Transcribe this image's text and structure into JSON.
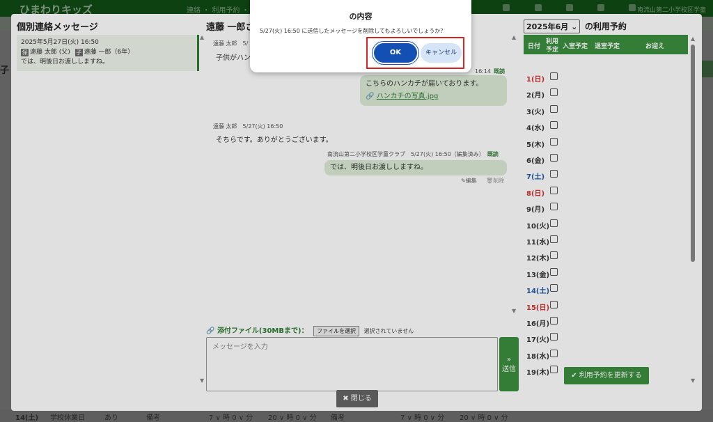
{
  "bg": {
    "app_name": "ひまわりキッズ",
    "menu": "連絡 ・ 利用予約 ・ 登降所",
    "user": "南流山第二小学校区学童",
    "side_label": "子",
    "footer": {
      "day": "14(土)",
      "c1": "学校休業日",
      "c2": "あり",
      "c3": "備考",
      "c4": "7 ∨ 時 0 ∨ 分",
      "c5": "20 ∨ 時 0 ∨ 分",
      "c6": "備考",
      "c7": "7 ∨ 時 0 ∨ 分",
      "c8": "20 ∨ 時 0 ∨ 分"
    }
  },
  "left": {
    "title": "個別連絡メッセージ",
    "conv": {
      "date": "2025年5月27日(火) 16:50",
      "parent_tag": "保",
      "parent": "遠藤 太郎 (父)",
      "child_tag": "子",
      "child": "遠藤 一郎（6年）",
      "preview": "では、明後日お渡ししますね。"
    }
  },
  "mid": {
    "title": "遠藤 一郎さ",
    "msg1": {
      "meta": "遠藤 太郎　5/",
      "text": "子供がハン"
    },
    "msg2": {
      "meta_tail": "16:14",
      "read": "既読",
      "text": "こちらのハンカチが届いております。",
      "attachment": "ハンカチの写真.jpg"
    },
    "msg3": {
      "meta": "遠藤 太郎　5/27(火) 16:50",
      "text": "そちらです。ありがとうございます。"
    },
    "msg4": {
      "meta": "南流山第二小学校区学童クラブ　5/27(火) 16:50（編集済み）",
      "read": "既読",
      "text": "では、明後日お渡ししますね。",
      "edit": "編集",
      "delete": "削除"
    },
    "attach_label": "添付ファイル(30MBまで)：",
    "file_button": "ファイルを選択",
    "no_file": "選択されていません",
    "input_placeholder": "メッセージを入力",
    "send": "送信"
  },
  "right": {
    "month": "2025年6月",
    "title": "の利用予約",
    "headers": {
      "date": "日付",
      "use1": "利用",
      "use2": "予定",
      "enter": "入室予定",
      "leave": "退室予定",
      "pickup": "お迎え"
    },
    "rows": [
      {
        "d": "1(日)",
        "c": "#d32f2f"
      },
      {
        "d": "2(月)",
        "c": "#333333"
      },
      {
        "d": "3(火)",
        "c": "#333333"
      },
      {
        "d": "4(水)",
        "c": "#333333"
      },
      {
        "d": "5(木)",
        "c": "#333333"
      },
      {
        "d": "6(金)",
        "c": "#333333"
      },
      {
        "d": "7(土)",
        "c": "#1e5aa8"
      },
      {
        "d": "8(日)",
        "c": "#d32f2f"
      },
      {
        "d": "9(月)",
        "c": "#333333"
      },
      {
        "d": "10(火)",
        "c": "#333333"
      },
      {
        "d": "11(水)",
        "c": "#333333"
      },
      {
        "d": "12(木)",
        "c": "#333333"
      },
      {
        "d": "13(金)",
        "c": "#333333"
      },
      {
        "d": "14(土)",
        "c": "#1e5aa8"
      },
      {
        "d": "15(日)",
        "c": "#d32f2f"
      },
      {
        "d": "16(月)",
        "c": "#333333"
      },
      {
        "d": "17(火)",
        "c": "#333333"
      },
      {
        "d": "18(水)",
        "c": "#333333"
      },
      {
        "d": "19(木)",
        "c": "#333333"
      }
    ],
    "update": "利用予約を更新する"
  },
  "close": "閉じる",
  "dialog": {
    "title": "の内容",
    "message": "5/27(火) 16:50 に送信したメッセージを削除してもよろしいでしょうか？",
    "ok": "OK",
    "cancel": "キャンセル"
  }
}
